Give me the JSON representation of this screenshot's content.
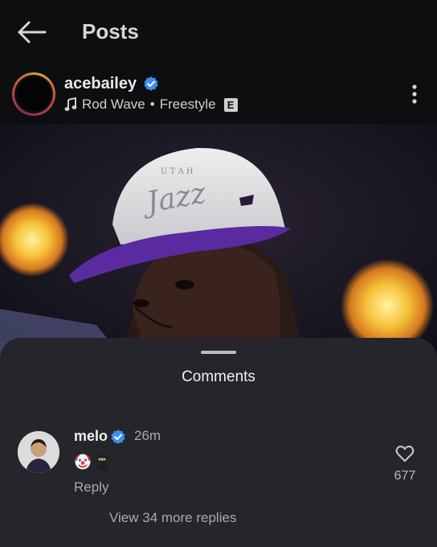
{
  "header": {
    "title": "Posts"
  },
  "post": {
    "username": "acebailey",
    "audio": {
      "artist": "Rod Wave",
      "separator": "•",
      "track": "Freestyle",
      "explicit_label": "E"
    },
    "image": {
      "cap_text": "Jazz",
      "cap_top_text": "U T A H"
    }
  },
  "comments_sheet": {
    "title": "Comments",
    "comment": {
      "username": "melo",
      "time": "26m",
      "emoji": [
        "clown-face",
        "ninja"
      ],
      "reply_label": "Reply",
      "like_count": "677"
    },
    "view_more_label": "View 34 more replies"
  },
  "colors": {
    "background": "#0d0e10",
    "sheet": "#25262b",
    "verified": "#3d8ef0",
    "cap_brim": "#5a2aa0"
  }
}
